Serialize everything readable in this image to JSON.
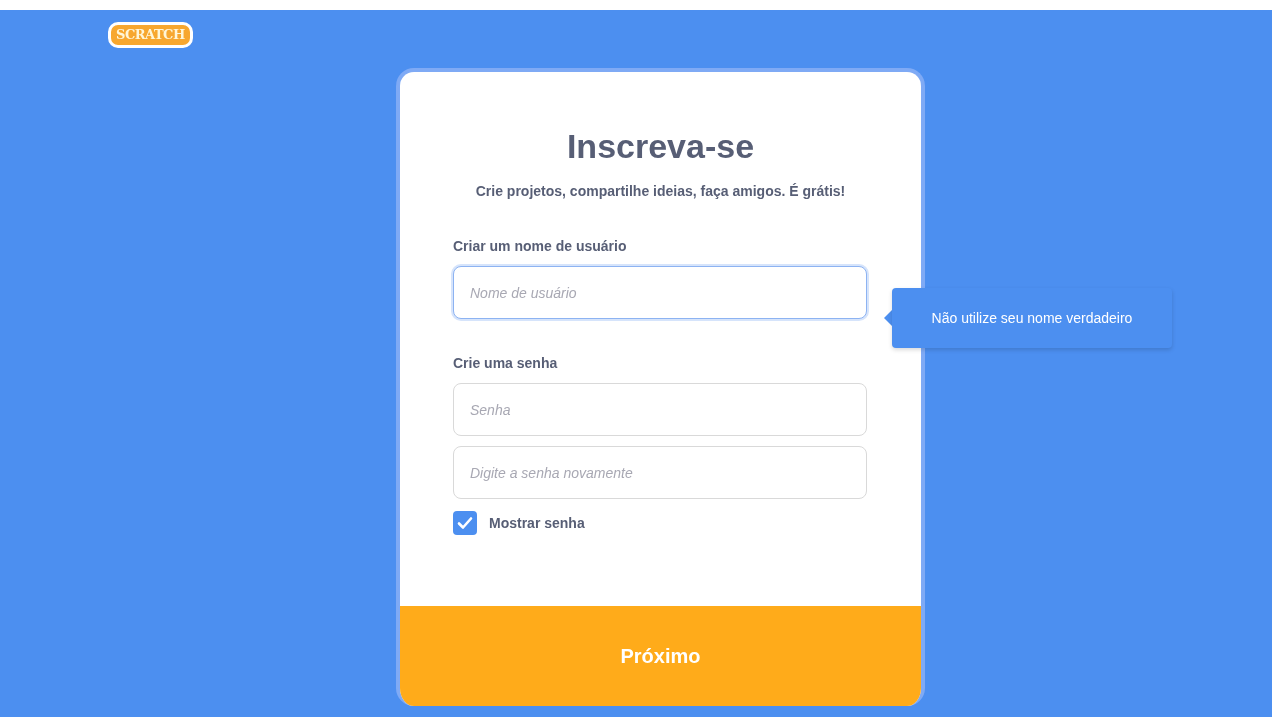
{
  "logo": {
    "text": "SCRATCH"
  },
  "card": {
    "title": "Inscreva-se",
    "subtitle": "Crie projetos, compartilhe ideias, faça amigos. É grátis!",
    "sections": [
      {
        "label": "Criar um nome de usuário",
        "fields": [
          {
            "placeholder": "Nome de usuário",
            "focused": true
          }
        ]
      },
      {
        "label": "Crie uma senha",
        "fields": [
          {
            "placeholder": "Senha",
            "focused": false
          },
          {
            "placeholder": "Digite a senha novamente",
            "focused": false
          }
        ]
      }
    ],
    "show_password": {
      "label": "Mostrar senha",
      "checked": true
    },
    "next_button": "Próximo"
  },
  "tooltip": {
    "text": "Não utilize seu nome verdadeiro"
  }
}
